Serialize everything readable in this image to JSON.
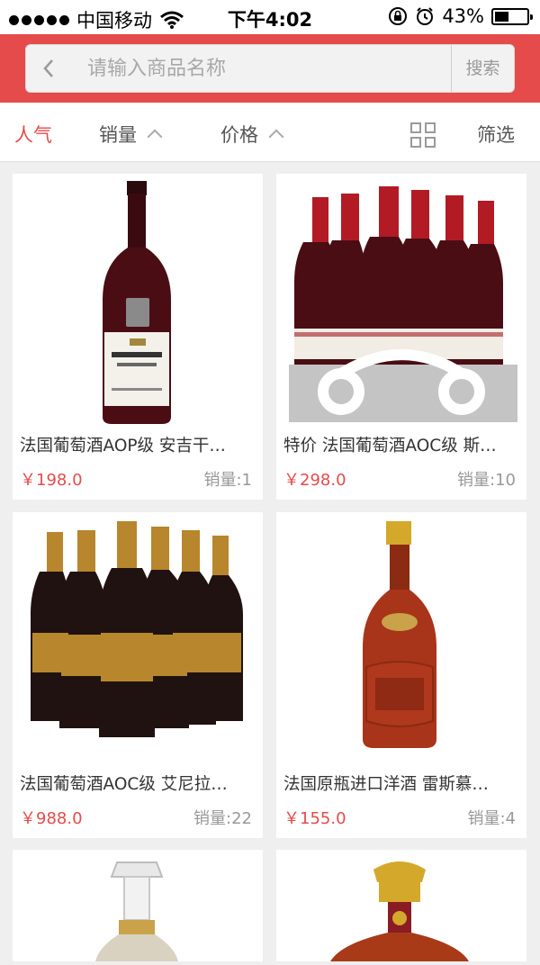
{
  "status_bar": {
    "carrier": "中国移动",
    "time": "下午4:02",
    "battery": "43%",
    "battery_level": 0.43,
    "wifi_icon": "wifi-icon",
    "lock_icon": "rotation-lock-icon",
    "alarm_icon": "alarm-icon"
  },
  "search": {
    "placeholder": "请输入商品名称",
    "value": "",
    "button_label": "搜索",
    "back_icon": "chevron-left-icon"
  },
  "sort_bar": {
    "items": [
      {
        "label": "人气",
        "active": true
      },
      {
        "label": "销量",
        "active": false
      },
      {
        "label": "价格",
        "active": false
      }
    ],
    "grid_icon": "grid-view-icon",
    "filter_label": "筛选"
  },
  "products": [
    {
      "title": "法国葡萄酒AOP级 安吉干…",
      "price": "￥198.0",
      "sales": "销量:1",
      "image": "wine-bottle-single"
    },
    {
      "title": "特价 法国葡萄酒AOC级 斯…",
      "price": "￥298.0",
      "sales": "销量:10",
      "image": "wine-bottles-six-with-watermark"
    },
    {
      "title": "法国葡萄酒AOC级 艾尼拉…",
      "price": "￥988.0",
      "sales": "销量:22",
      "image": "wine-bottles-six-gold"
    },
    {
      "title": "法国原瓶进口洋酒 雷斯慕…",
      "price": "￥155.0",
      "sales": "销量:4",
      "image": "brandy-bottle"
    },
    {
      "title": "",
      "price": "",
      "sales": "",
      "image": "crystal-decanter-bottle"
    },
    {
      "title": "",
      "price": "",
      "sales": "",
      "image": "cognac-bottle"
    }
  ],
  "colors": {
    "accent": "#e64b4b",
    "price": "#e64b4b",
    "wine_red": "#5a0f14",
    "gold": "#b8862c"
  }
}
